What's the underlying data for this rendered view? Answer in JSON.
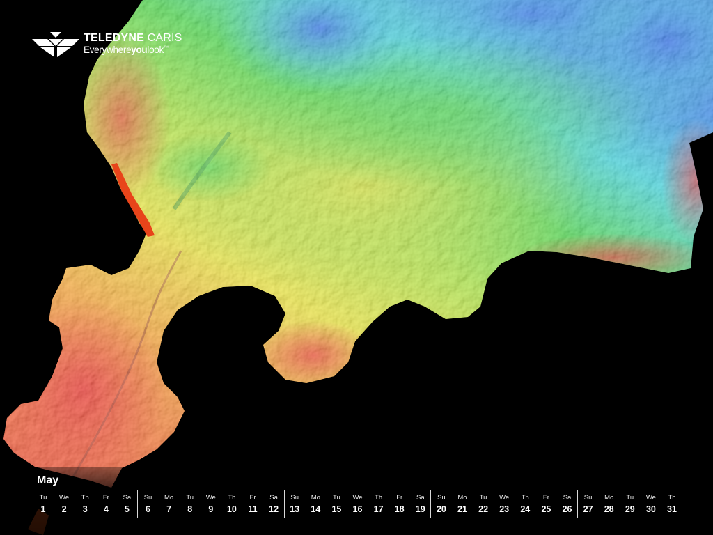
{
  "logo": {
    "brand_bold": "TELEDYNE",
    "brand_light": "CARIS",
    "tagline_a": "Everywhere",
    "tagline_b": "you",
    "tagline_c": "look",
    "tagline_tm": "™"
  },
  "calendar": {
    "month": "May",
    "days": [
      {
        "wd": "Tu",
        "n": "1"
      },
      {
        "wd": "We",
        "n": "2"
      },
      {
        "wd": "Th",
        "n": "3"
      },
      {
        "wd": "Fr",
        "n": "4"
      },
      {
        "wd": "Sa",
        "n": "5"
      },
      {
        "wd": "Su",
        "n": "6"
      },
      {
        "wd": "Mo",
        "n": "7"
      },
      {
        "wd": "Tu",
        "n": "8"
      },
      {
        "wd": "We",
        "n": "9"
      },
      {
        "wd": "Th",
        "n": "10"
      },
      {
        "wd": "Fr",
        "n": "11"
      },
      {
        "wd": "Sa",
        "n": "12"
      },
      {
        "wd": "Su",
        "n": "13"
      },
      {
        "wd": "Mo",
        "n": "14"
      },
      {
        "wd": "Tu",
        "n": "15"
      },
      {
        "wd": "We",
        "n": "16"
      },
      {
        "wd": "Th",
        "n": "17"
      },
      {
        "wd": "Fr",
        "n": "18"
      },
      {
        "wd": "Sa",
        "n": "19"
      },
      {
        "wd": "Su",
        "n": "20"
      },
      {
        "wd": "Mo",
        "n": "21"
      },
      {
        "wd": "Tu",
        "n": "22"
      },
      {
        "wd": "We",
        "n": "23"
      },
      {
        "wd": "Th",
        "n": "24"
      },
      {
        "wd": "Fr",
        "n": "25"
      },
      {
        "wd": "Sa",
        "n": "26"
      },
      {
        "wd": "Su",
        "n": "27"
      },
      {
        "wd": "Mo",
        "n": "28"
      },
      {
        "wd": "Tu",
        "n": "29"
      },
      {
        "wd": "We",
        "n": "30"
      },
      {
        "wd": "Th",
        "n": "31"
      }
    ]
  },
  "colors": {
    "background": "#000000",
    "deep": "#1f6fe8",
    "mid_deep": "#2fd0d8",
    "mid": "#39d23a",
    "shallow_mid": "#e8e22a",
    "shallow": "#f08a1c",
    "shallowest": "#e61a1a",
    "text": "#ffffff"
  }
}
